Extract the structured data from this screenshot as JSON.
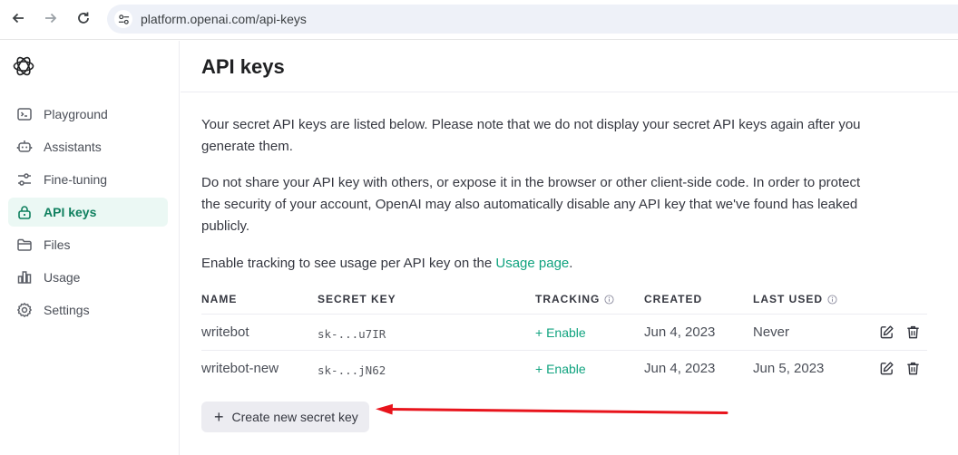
{
  "browser": {
    "url": "platform.openai.com/api-keys"
  },
  "sidebar": {
    "items": [
      {
        "label": "Playground",
        "icon": "terminal-icon",
        "active": false
      },
      {
        "label": "Assistants",
        "icon": "robot-icon",
        "active": false
      },
      {
        "label": "Fine-tuning",
        "icon": "sliders-icon",
        "active": false
      },
      {
        "label": "API keys",
        "icon": "lock-icon",
        "active": true
      },
      {
        "label": "Files",
        "icon": "folder-icon",
        "active": false
      },
      {
        "label": "Usage",
        "icon": "bar-chart-icon",
        "active": false
      },
      {
        "label": "Settings",
        "icon": "gear-icon",
        "active": false
      }
    ]
  },
  "main": {
    "title": "API keys",
    "para1": "Your secret API keys are listed below. Please note that we do not display your secret API keys again after you generate them.",
    "para2": "Do not share your API key with others, or expose it in the browser or other client-side code. In order to protect the security of your account, OpenAI may also automatically disable any API key that we've found has leaked publicly.",
    "para3_prefix": "Enable tracking to see usage per API key on the ",
    "para3_link": "Usage page",
    "para3_suffix": ".",
    "table": {
      "headers": {
        "name": "NAME",
        "secret_key": "SECRET KEY",
        "tracking": "TRACKING",
        "created": "CREATED",
        "last_used": "LAST USED"
      },
      "rows": [
        {
          "name": "writebot",
          "secret_key": "sk-...u7IR",
          "tracking": "+ Enable",
          "created": "Jun 4, 2023",
          "last_used": "Never"
        },
        {
          "name": "writebot-new",
          "secret_key": "sk-...jN62",
          "tracking": "+ Enable",
          "created": "Jun 4, 2023",
          "last_used": "Jun 5, 2023"
        }
      ]
    },
    "create_button": "Create new secret key"
  },
  "colors": {
    "accent": "#10a37f",
    "active_bg": "#ebf8f4",
    "annotation_arrow": "#e8141c"
  }
}
